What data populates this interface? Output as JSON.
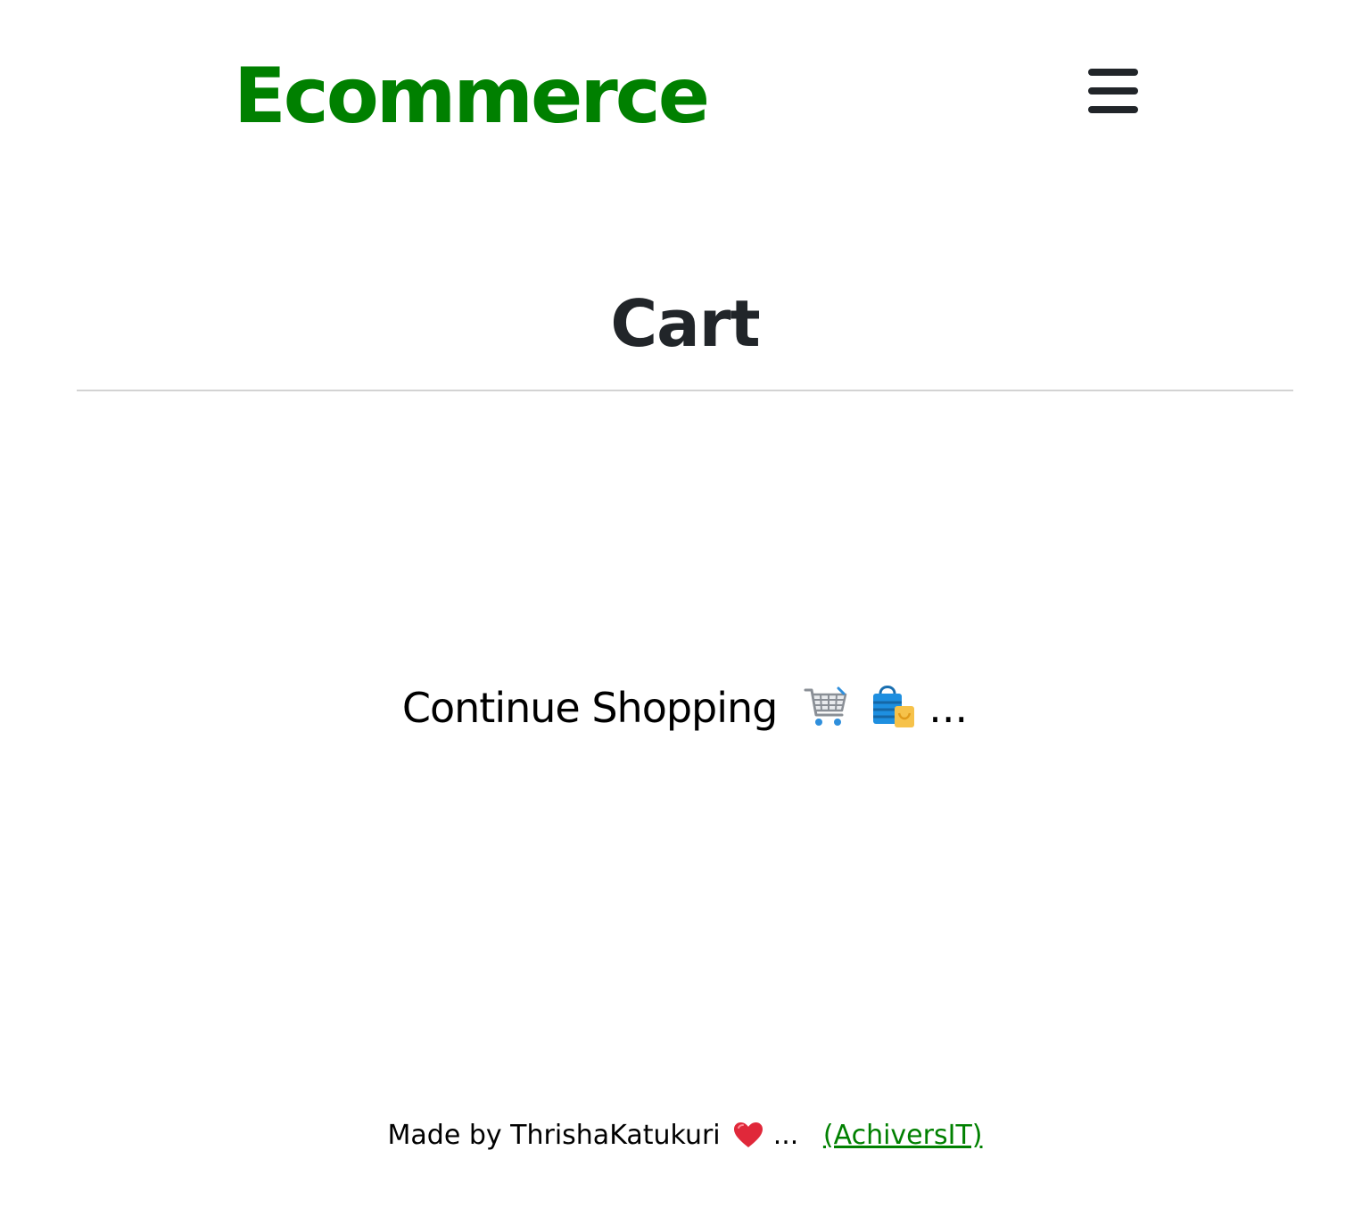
{
  "navbar": {
    "brand": "Ecommerce",
    "brand_color": "#008000",
    "menu_icon": "hamburger-menu-icon"
  },
  "main": {
    "title": "Cart",
    "continue_label": "Continue Shopping",
    "continue_icons": [
      "shopping-cart-icon",
      "shopping-bags-icon"
    ],
    "continue_ellipsis": "..."
  },
  "footer": {
    "made_by": "Made by ThrishaKatukuri",
    "heart_icon": "red-heart-icon",
    "ellipsis": "...",
    "link_label": "(AchiversIT)",
    "link_color": "#008000"
  }
}
